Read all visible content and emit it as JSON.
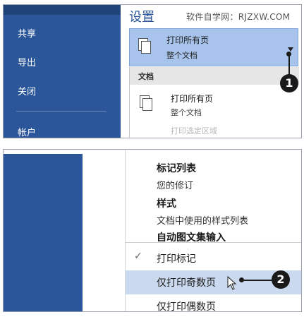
{
  "top": {
    "sidebar": {
      "items": [
        {
          "label": "共享"
        },
        {
          "label": "导出"
        },
        {
          "label": "关闭"
        },
        {
          "label": "帐户"
        }
      ]
    },
    "settings_title": "设置",
    "watermark": "软件自学网：RJZXW.COM",
    "dropdown": {
      "primary": "打印所有页",
      "secondary": "整个文档"
    },
    "menu": {
      "section_label": "文档",
      "item_primary": "打印所有页",
      "item_secondary": "整个文档",
      "item_faded": "打印选定区域"
    },
    "callout": "1"
  },
  "bottom": {
    "groups": [
      {
        "title": "标记列表",
        "desc": "您的修订"
      },
      {
        "title": "样式",
        "desc": "文档中使用的样式列表"
      },
      {
        "title": "自动图文集输入"
      }
    ],
    "print_markup": {
      "check": "✓",
      "label": "打印标记"
    },
    "odd_pages": {
      "label": "仅打印奇数页"
    },
    "even_pages": {
      "label": "仅打印偶数页"
    },
    "callout": "2"
  },
  "colors": {
    "sidebar": "#2b579a",
    "accent_title": "#2b579a",
    "dropdown_selected": "#a9c4ec",
    "menu_highlight": "#cbd9ee",
    "callout": "#1a1a1a"
  }
}
